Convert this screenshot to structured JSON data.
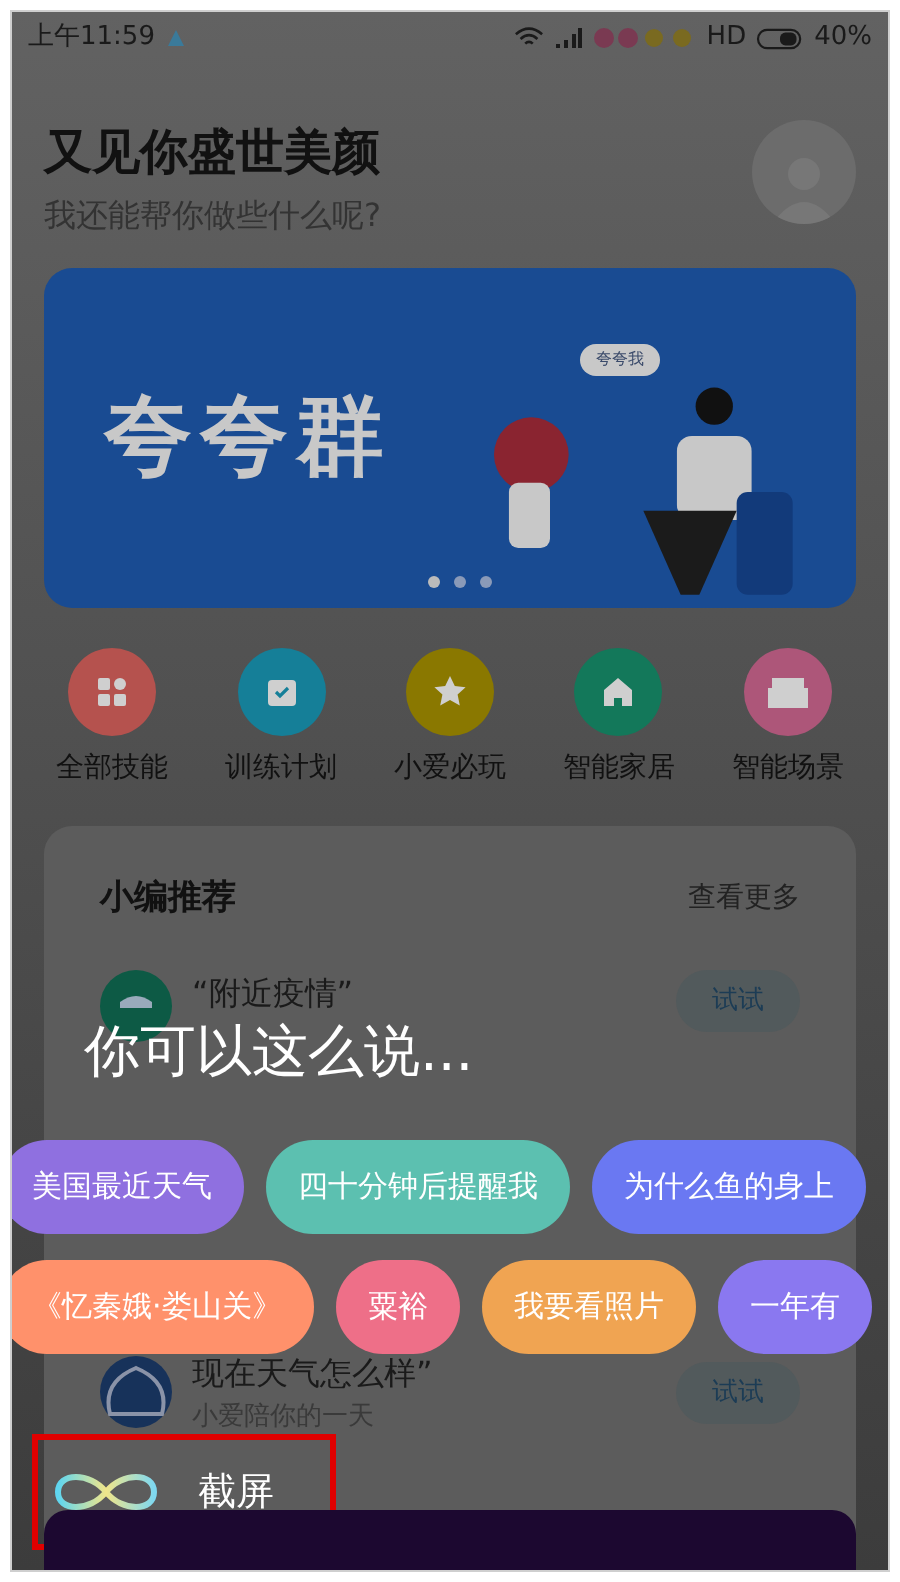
{
  "status_bar": {
    "time": "上午11:59",
    "network": "HD",
    "battery": "40%"
  },
  "header": {
    "title": "又见你盛世美颜",
    "subtitle": "我还能帮你做些什么呢?"
  },
  "banner": {
    "title": "夸夸群",
    "bubble": "夸夸我"
  },
  "shortcuts": [
    {
      "label": "全部技能",
      "kind": "grid",
      "color": "#b5524e"
    },
    {
      "label": "训练计划",
      "kind": "calendar",
      "color": "#157f98"
    },
    {
      "label": "小爱必玩",
      "kind": "star",
      "color": "#8a7800"
    },
    {
      "label": "智能家居",
      "kind": "home",
      "color": "#13785a"
    },
    {
      "label": "智能场景",
      "kind": "sofa",
      "color": "#ad5679"
    }
  ],
  "recommend": {
    "title": "小编推荐",
    "more": "查看更多",
    "items": [
      {
        "kind": "virus",
        "title": "“附近疫情”",
        "button": "试试"
      },
      {
        "kind": "weather",
        "title": "现在天气怎么样”",
        "subtitle": "小爱陪你的一天",
        "button": "试试"
      }
    ]
  },
  "voice_overlay": {
    "prompt": "你可以这么说...",
    "suggestion_rows": [
      [
        {
          "text": "美国最近天气",
          "color": "#8f70e0"
        },
        {
          "text": "四十分钟后提醒我",
          "color": "#5cc0b0"
        },
        {
          "text": "为什么鱼的身上",
          "color": "#6a78f2"
        }
      ],
      [
        {
          "text": "《忆秦娥·娄山关》",
          "color": "#ff916b"
        },
        {
          "text": "粟裕",
          "color": "#ee6f88"
        },
        {
          "text": "我要看照片",
          "color": "#f0a452"
        },
        {
          "text": "一年有",
          "color": "#8a78f0"
        }
      ]
    ],
    "assistant": {
      "label": "截屏"
    }
  }
}
